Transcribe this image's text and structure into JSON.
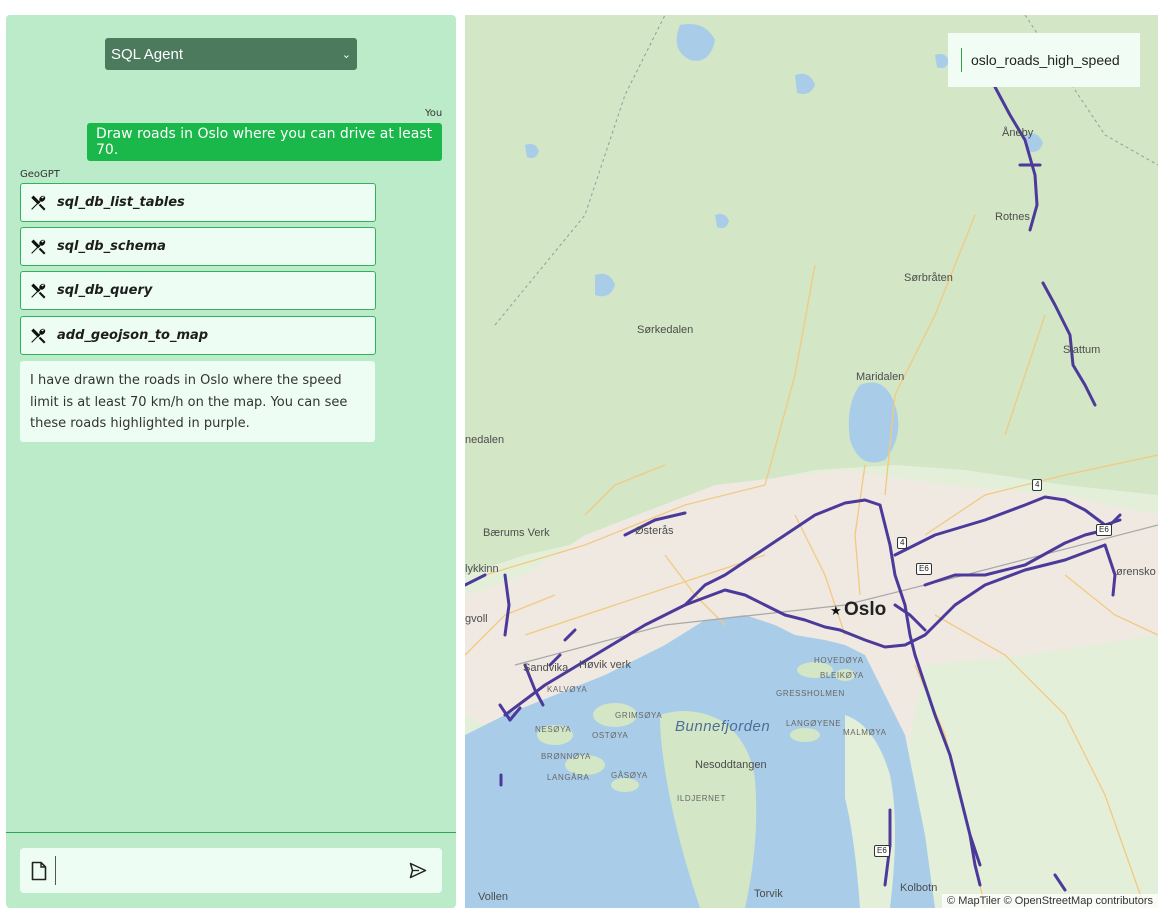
{
  "agent_select": {
    "value": "SQL Agent"
  },
  "chat": {
    "user_label": "You",
    "user_message": "Draw roads in Oslo where you can drive at least 70.",
    "agent_label": "GeoGPT",
    "tool_calls": [
      {
        "name": "sql_db_list_tables",
        "icon": "tools-icon"
      },
      {
        "name": "sql_db_schema",
        "icon": "tools-icon"
      },
      {
        "name": "sql_db_query",
        "icon": "tools-icon"
      },
      {
        "name": "add_geojson_to_map",
        "icon": "tools-icon"
      }
    ],
    "agent_reply": "I have drawn the roads in Oslo where the speed limit is at least 70 km/h on the map. You can see these roads highlighted in purple."
  },
  "composer": {
    "placeholder": "",
    "attach_icon": "file-icon",
    "send_icon": "send-icon"
  },
  "map": {
    "layer_name": "oslo_roads_high_speed",
    "layer_color": "#4b3a9a",
    "attribution": "© MapTiler © OpenStreetMap contributors",
    "places": {
      "aneby": "Åneby",
      "rotnes": "Rotnes",
      "sorbraten": "Sørbråten",
      "sorkedalen": "Sørkedalen",
      "slattum": "Slattum",
      "maridalen": "Maridalen",
      "nedalen": "nedalen",
      "baerums_verk": "Bærums Verk",
      "osteras": "Østerås",
      "lykkinn": "lykkinn",
      "gvoll": "gvoll",
      "oslo": "Oslo",
      "sandvika": "Sandvika",
      "hovik_verk": "Høvik verk",
      "kalvoya": "KALVØYA",
      "hovedoya": "HOVEDØYA",
      "bleikoya": "BLEIKØYA",
      "gressholmen": "GRESSHOLMEN",
      "grimsoya": "GRIMSØYA",
      "nesoya": "NESØYA",
      "ostoya": "OSTØYA",
      "langoyene": "LANGØYENE",
      "malmoya": "MALMØYA",
      "bunnefjorden": "Bunnefjorden",
      "bronnoya": "BRØNNØYA",
      "nesoddtangen": "Nesoddtangen",
      "langara": "LANGÅRA",
      "gasoya": "GÅSØYA",
      "ildjernet": "ILDJERNET",
      "lorenskog": "ørensko",
      "kolbotn": "Kolbotn",
      "torvik": "Torvik",
      "vollen": "Vollen"
    },
    "road_shields": {
      "r4a": "4",
      "r4b": "4",
      "e6a": "E6",
      "e6b": "E6",
      "e6c": "E6"
    }
  }
}
